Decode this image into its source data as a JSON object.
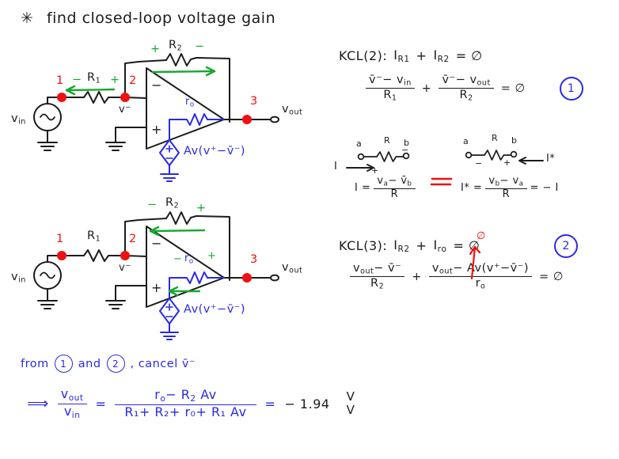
{
  "page": {
    "title_marker": "✳",
    "title": "find closed-loop voltage gain",
    "bg_color": "#ffffff",
    "ink_color": "#1c1c1c",
    "red_color": "#ee1111",
    "green_color": "#18a830",
    "blue_color": "#2a2ae8"
  },
  "circuit1": {
    "source_label": "v",
    "source_sub": "in",
    "node1": "1",
    "node2": "2",
    "node3": "3",
    "r1_label": "R",
    "r1_sub": "1",
    "r1_sign_left": "−",
    "r1_sign_right": "+",
    "r2_label": "R",
    "r2_sub": "2",
    "r2_sign_left": "+",
    "r2_sign_right": "−",
    "r2_arrow_dir": "right",
    "r1_arrow_dir": "left",
    "vminus_label": "v",
    "vminus_sup": "−",
    "opamp_minus": "−",
    "opamp_plus": "+",
    "ro_label": "r",
    "ro_sub": "o",
    "dep_source_plus": "+",
    "dep_source_minus": "−",
    "dep_source_expr": "Av(v⁺−v̄⁻)",
    "vout_label": "v",
    "vout_sub": "out"
  },
  "circuit2": {
    "source_label": "v",
    "source_sub": "in",
    "node1": "1",
    "node2": "2",
    "node3": "3",
    "r1_label": "R",
    "r1_sub": "1",
    "r2_label": "R",
    "r2_sub": "2",
    "r2_sign_left": "−",
    "r2_sign_right": "+",
    "r2_arrow_dir": "left",
    "ro_label": "r",
    "ro_sub": "o",
    "ro_sign_left": "−",
    "ro_sign_right": "+",
    "ro_arrow_dir": "left",
    "vminus_label": "v",
    "vminus_sup": "−",
    "opamp_minus": "−",
    "opamp_plus": "+",
    "dep_source_plus": "+",
    "dep_source_minus": "−",
    "dep_source_expr": "Av(v⁺−v̄⁻)",
    "vout_label": "v",
    "vout_sub": "out"
  },
  "kcl2": {
    "heading": "KCL(2):",
    "terms": "I",
    "term1_sub": "R1",
    "plus": "+",
    "term2": "I",
    "term2_sub": "R2",
    "equals_zero": "= ∅",
    "eq_num": "1",
    "f1_num": "v̄⁻− v",
    "f1_num_sub": "in",
    "f1_den": "R",
    "f1_den_sub": "1",
    "f2_num": "v̄⁻− v",
    "f2_num_sub": "out",
    "f2_den": "R",
    "f2_den_sub": "2",
    "tail": "= ∅"
  },
  "convention_note": {
    "lead_i": "I",
    "left_node_a": "a",
    "left_node_b": "b",
    "left_r": "R",
    "left_sign_plus": "+",
    "left_sign_minus": "−",
    "left_eq_lhs": "I =",
    "left_num": "v",
    "left_num_a": "a",
    "left_num_minus": "− v̄",
    "left_num_b": "b",
    "left_den": "R",
    "equiv": "≡",
    "right_node_a": "a",
    "right_node_b": "b",
    "right_r": "R",
    "right_sign_minus": "−",
    "right_sign_plus": "+",
    "right_istar": "I*",
    "right_eq_lhs": "I* =",
    "right_num": "v",
    "right_num_b": "b",
    "right_num_minus": "− v",
    "right_num_a": "a",
    "right_den": "R",
    "right_tail": "= − I"
  },
  "kcl3": {
    "heading": "KCL(3):",
    "term1": "I",
    "term1_sub": "R2",
    "plus": "+",
    "term2": "I",
    "term2_sub": "o",
    "term2_presub": "r",
    "equals_zero": "= ∅",
    "eq_num": "2",
    "annotation_zero": "∅",
    "f1_num_a": "v",
    "f1_num_a_sub": "out",
    "f1_num_rest": "− v̄⁻",
    "f1_den": "R",
    "f1_den_sub": "2",
    "f2_num_a": "v",
    "f2_num_a_sub": "out",
    "f2_num_rest": "− Av(v⁺−v̄⁻)",
    "f2_den": "r",
    "f2_den_sub": "o",
    "tail": "= ∅"
  },
  "conclusion": {
    "lead": "from",
    "ref1": "1",
    "and": "and",
    "ref2": "2",
    "comma_cancel": ", cancel v̄⁻",
    "arrow": "⟹",
    "lhs_num": "v",
    "lhs_num_sub": "out",
    "lhs_den": "v",
    "lhs_den_sub": "in",
    "equals": "=",
    "rhs_num_a": "r",
    "rhs_num_a_sub": "o",
    "rhs_num_rest": "− R",
    "rhs_num_r2_sub": "2",
    "rhs_num_av": "Av",
    "rhs_den": "R₁+ R₂+ r₀+ R₁ Av",
    "result_equals": "=",
    "result_value": "− 1.94",
    "result_unit_num": "V",
    "result_unit_den": "V"
  }
}
